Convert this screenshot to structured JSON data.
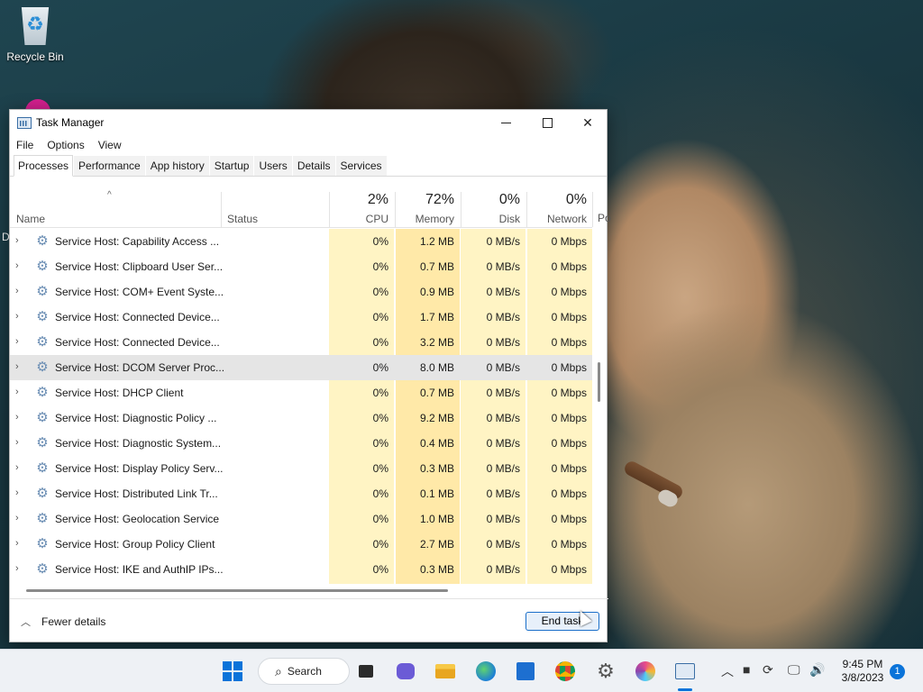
{
  "desktop": {
    "recycle_bin_label": "Recycle Bin",
    "partial_icon_letter": "D"
  },
  "window": {
    "title": "Task Manager",
    "menu": [
      "File",
      "Options",
      "View"
    ],
    "tabs": [
      "Processes",
      "Performance",
      "App history",
      "Startup",
      "Users",
      "Details",
      "Services"
    ],
    "active_tab": "Processes"
  },
  "columns": {
    "name": "Name",
    "status": "Status",
    "cpu": {
      "pct": "2%",
      "label": "CPU"
    },
    "memory": {
      "pct": "72%",
      "label": "Memory"
    },
    "disk": {
      "pct": "0%",
      "label": "Disk"
    },
    "network": {
      "pct": "0%",
      "label": "Network"
    },
    "power_partial": "Po"
  },
  "processes": [
    {
      "name": "Service Host: Capability Access ...",
      "cpu": "0%",
      "memory": "1.2 MB",
      "disk": "0 MB/s",
      "network": "0 Mbps"
    },
    {
      "name": "Service Host: Clipboard User Ser...",
      "cpu": "0%",
      "memory": "0.7 MB",
      "disk": "0 MB/s",
      "network": "0 Mbps"
    },
    {
      "name": "Service Host: COM+ Event Syste...",
      "cpu": "0%",
      "memory": "0.9 MB",
      "disk": "0 MB/s",
      "network": "0 Mbps"
    },
    {
      "name": "Service Host: Connected Device...",
      "cpu": "0%",
      "memory": "1.7 MB",
      "disk": "0 MB/s",
      "network": "0 Mbps"
    },
    {
      "name": "Service Host: Connected Device...",
      "cpu": "0%",
      "memory": "3.2 MB",
      "disk": "0 MB/s",
      "network": "0 Mbps"
    },
    {
      "name": "Service Host: DCOM Server Proc...",
      "cpu": "0%",
      "memory": "8.0 MB",
      "disk": "0 MB/s",
      "network": "0 Mbps",
      "selected": true
    },
    {
      "name": "Service Host: DHCP Client",
      "cpu": "0%",
      "memory": "0.7 MB",
      "disk": "0 MB/s",
      "network": "0 Mbps"
    },
    {
      "name": "Service Host: Diagnostic Policy ...",
      "cpu": "0%",
      "memory": "9.2 MB",
      "disk": "0 MB/s",
      "network": "0 Mbps"
    },
    {
      "name": "Service Host: Diagnostic System...",
      "cpu": "0%",
      "memory": "0.4 MB",
      "disk": "0 MB/s",
      "network": "0 Mbps"
    },
    {
      "name": "Service Host: Display Policy Serv...",
      "cpu": "0%",
      "memory": "0.3 MB",
      "disk": "0 MB/s",
      "network": "0 Mbps"
    },
    {
      "name": "Service Host: Distributed Link Tr...",
      "cpu": "0%",
      "memory": "0.1 MB",
      "disk": "0 MB/s",
      "network": "0 Mbps"
    },
    {
      "name": "Service Host: Geolocation Service",
      "cpu": "0%",
      "memory": "1.0 MB",
      "disk": "0 MB/s",
      "network": "0 Mbps"
    },
    {
      "name": "Service Host: Group Policy Client",
      "cpu": "0%",
      "memory": "2.7 MB",
      "disk": "0 MB/s",
      "network": "0 Mbps"
    },
    {
      "name": "Service Host: IKE and AuthIP IPs...",
      "cpu": "0%",
      "memory": "0.3 MB",
      "disk": "0 MB/s",
      "network": "0 Mbps"
    }
  ],
  "footer": {
    "fewer_details": "Fewer details",
    "end_task": "End task"
  },
  "taskbar": {
    "search_label": "Search",
    "time": "9:45 PM",
    "date": "3/8/2023",
    "notification_count": "1"
  },
  "colors": {
    "accent": "#0a73d9",
    "heat_light": "#fff4c4",
    "heat_memory": "#ffe9a8",
    "selected_row": "#e5e5e5"
  }
}
